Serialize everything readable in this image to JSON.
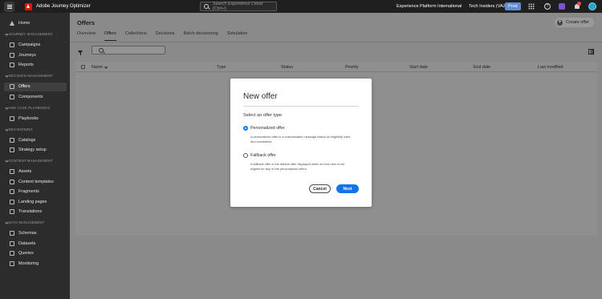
{
  "topbar": {
    "app_name": "Adobe Journey Optimizer",
    "search_placeholder": "Search Experience Cloud (Ctrl+/)",
    "org_name": "Experience Platform International",
    "sandbox_name": "Tech Insiders (VAZ)",
    "environment_badge": "Prod"
  },
  "sidebar": {
    "home": "Home",
    "sections": [
      {
        "title": "Journey Management",
        "items": [
          "Campaigns",
          "Journeys",
          "Reports"
        ]
      },
      {
        "title": "Decision Management",
        "items": [
          "Offers",
          "Components"
        ]
      },
      {
        "title": "Use Case Playbooks",
        "items": [
          "Playbooks"
        ]
      },
      {
        "title": "Decisioning",
        "items": [
          "Catalogs",
          "Strategy setup"
        ]
      },
      {
        "title": "Content Management",
        "items": [
          "Assets",
          "Content templates",
          "Fragments",
          "Landing pages",
          "Translations"
        ]
      },
      {
        "title": "Data Management",
        "items": [
          "Schemas",
          "Datasets",
          "Queries",
          "Monitoring"
        ]
      }
    ],
    "active_item": "Offers"
  },
  "page": {
    "title": "Offers",
    "create_button": "Create offer",
    "tabs": [
      "Overview",
      "Offers",
      "Collections",
      "Decisions",
      "Batch decisioning",
      "Simulation"
    ],
    "active_tab": "Offers"
  },
  "table": {
    "columns": [
      "Name",
      "Type",
      "Status",
      "Priority",
      "Start date",
      "End date",
      "Last modified"
    ]
  },
  "modal": {
    "title": "New offer",
    "subtitle": "Select an offer type",
    "options": [
      {
        "label": "Personalized offer",
        "description": "A personalized offer is a customizable message based on eligibility rules and constraints.",
        "selected": true
      },
      {
        "label": "Fallback offer",
        "description": "A fallback offer is the default offer displayed when an end user is not eligible for any of the personalized offers.",
        "selected": false
      }
    ],
    "cancel_label": "Cancel",
    "next_label": "Next"
  },
  "colors": {
    "accent": "#1473e6",
    "brand": "#eb1000"
  }
}
